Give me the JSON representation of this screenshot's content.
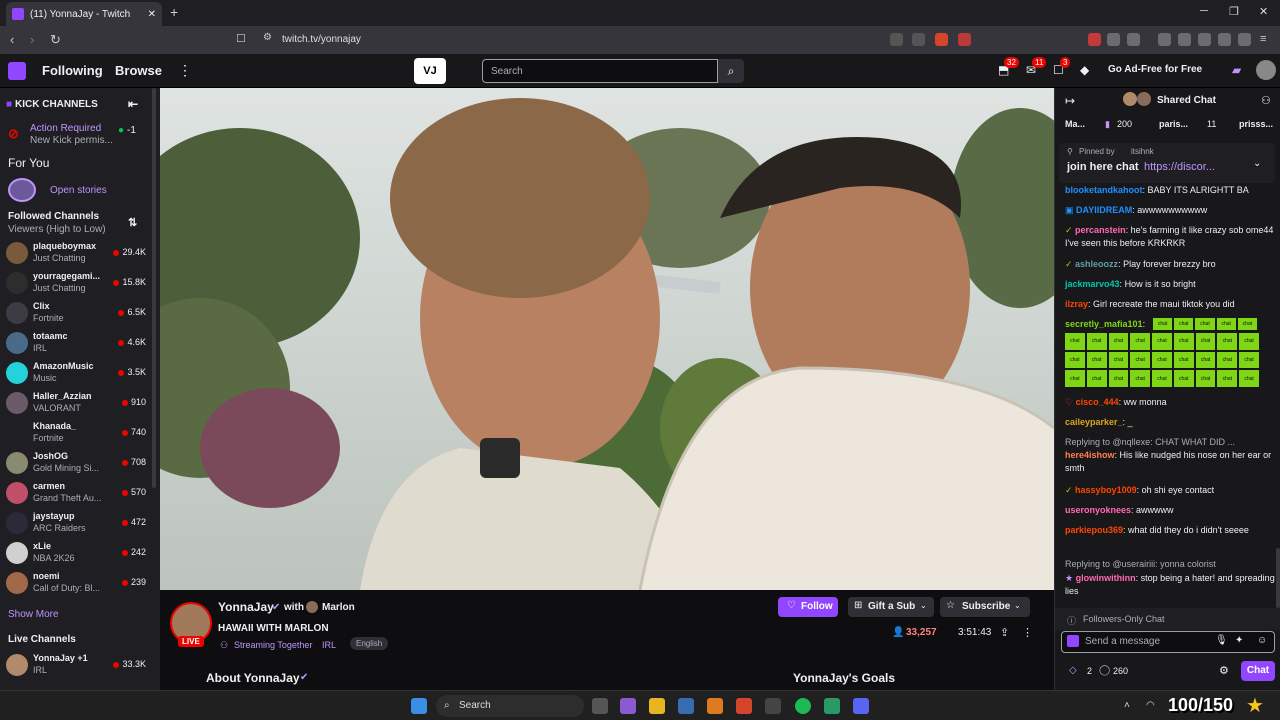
{
  "browser": {
    "tab_title": "(11) YonnaJay - Twitch",
    "url": "twitch.tv/yonnajay"
  },
  "topnav": {
    "following": "Following",
    "browse": "Browse",
    "ext_logo": "VJ",
    "search_placeholder": "Search",
    "badges": [
      "32",
      "11",
      "3"
    ],
    "ad_free": "Go Ad-Free for Free"
  },
  "sidebar": {
    "kick_channels": "KICK CHANNELS",
    "action_required": "Action Required",
    "action_sub": "New Kick permis...",
    "action_count": "-1",
    "for_you": "For You",
    "open_stories": "Open stories",
    "followed_channels": "Followed Channels",
    "sort": "Viewers (High to Low)",
    "channels": [
      {
        "name": "plaqueboymax",
        "game": "Just Chatting",
        "viewers": "29.4K",
        "color": "#7a5a3c"
      },
      {
        "name": "yourragegami...",
        "game": "Just Chatting",
        "viewers": "15.8K",
        "color": "#2d2d2d"
      },
      {
        "name": "Clix",
        "game": "Fortnite",
        "viewers": "6.5K",
        "color": "#3c3c44"
      },
      {
        "name": "totaamc",
        "game": "IRL",
        "viewers": "4.6K",
        "color": "#4a6a8a"
      },
      {
        "name": "AmazonMusic",
        "game": "Music",
        "viewers": "3.5K",
        "color": "#25d1da"
      },
      {
        "name": "Haller_Azzian",
        "game": "VALORANT",
        "viewers": "910",
        "color": "#6a5a6a"
      },
      {
        "name": "Khanada_",
        "game": "Fortnite",
        "viewers": "740",
        "color": "#1e1e26"
      },
      {
        "name": "JoshOG",
        "game": "Gold Mining Si...",
        "viewers": "708",
        "color": "#8a8a70"
      },
      {
        "name": "carmen",
        "game": "Grand Theft Au...",
        "viewers": "570",
        "color": "#c0506a"
      },
      {
        "name": "jaystayup",
        "game": "ARC Raiders",
        "viewers": "472",
        "color": "#2a2a3a"
      },
      {
        "name": "xLie",
        "game": "NBA 2K26",
        "viewers": "242",
        "color": "#d0d0d0"
      },
      {
        "name": "noemi",
        "game": "Call of Duty: Bl...",
        "viewers": "239",
        "color": "#a06a4a"
      }
    ],
    "show_more": "Show More",
    "live_channels": "Live Channels",
    "live": {
      "name": "YonnaJay +1",
      "game": "IRL",
      "viewers": "33.3K"
    }
  },
  "stream": {
    "streamer": "YonnaJay",
    "with": "with",
    "partner": "Marlon",
    "live_badge": "LIVE",
    "title": "HAWAII WITH MARLON",
    "streaming_together": "Streaming Together",
    "category": "IRL",
    "language": "English",
    "follow": "Follow",
    "gift": "Gift a Sub",
    "subscribe": "Subscribe",
    "viewers": "33,257",
    "uptime": "3:51:43",
    "about": "About YonnaJay",
    "goals": "YonnaJay's Goals"
  },
  "chat": {
    "header": "Shared Chat",
    "leaderboard": [
      {
        "name": "Ma...",
        "value": "200"
      },
      {
        "name": "paris...",
        "value": "11"
      },
      {
        "name": "prisss...",
        "value": ""
      }
    ],
    "pinned_by": "Pinned by",
    "pinned_user": "itsihnk",
    "pinned_text": "join here chat",
    "pinned_link": "https://discor...",
    "messages": [
      {
        "user": "blooketandkahoot",
        "color": "#1e90ff",
        "text": "BABY ITS ALRIGHTT BA"
      },
      {
        "user": "DAYIIDREAM",
        "color": "#1e90ff",
        "text": "awwwwwwwwww"
      },
      {
        "user": "percanstein",
        "color": "#ff69b4",
        "text": "he's farming it like crazy sob ome44 I've seen this before KRKRKR"
      },
      {
        "user": "ashleoozz",
        "color": "#5f9ea0",
        "text": "Play forever brezzy bro"
      },
      {
        "user": "jackmarvo43",
        "color": "#00c8af",
        "text": "How is it so bright"
      },
      {
        "user": "ilzray",
        "color": "#ff4500",
        "text": "Girl recreate the maui tiktok you did"
      },
      {
        "user": "secretly_mafia101",
        "color": "#7fd615",
        "text": ""
      },
      {
        "user": "cisco_444",
        "color": "#ff4500",
        "text": "ww monna"
      },
      {
        "user": "caileyparker_",
        "color": "#daa520",
        "text": "_"
      },
      {
        "user": "here4ishow",
        "color": "#ff7f50",
        "text": "His like nudged his nose on her ear or smth"
      },
      {
        "user": "hassyboy1009",
        "color": "#ff4500",
        "text": "oh shi eye contact"
      },
      {
        "user": "useronyoknees",
        "color": "#ff69b4",
        "text": "awwwww"
      },
      {
        "user": "parkiepou369",
        "color": "#ff4500",
        "text": "what did they do i didn't seeee"
      },
      {
        "user": "glowinwithinn",
        "color": "#ff69b4",
        "text": "stop being a hater! and spreading lies"
      }
    ],
    "reply1": "Replying to @nqllexe: CHAT WHAT DID ...",
    "reply2": "Replying to @userairiii: yonna colorist",
    "chat_word": "chat",
    "followers_only": "Followers-Only Chat",
    "send_placeholder": "Send a message",
    "points_a": "2",
    "points_b": "260",
    "chat_button": "Chat"
  },
  "taskbar": {
    "search": "Search",
    "overlay": "100/150"
  }
}
